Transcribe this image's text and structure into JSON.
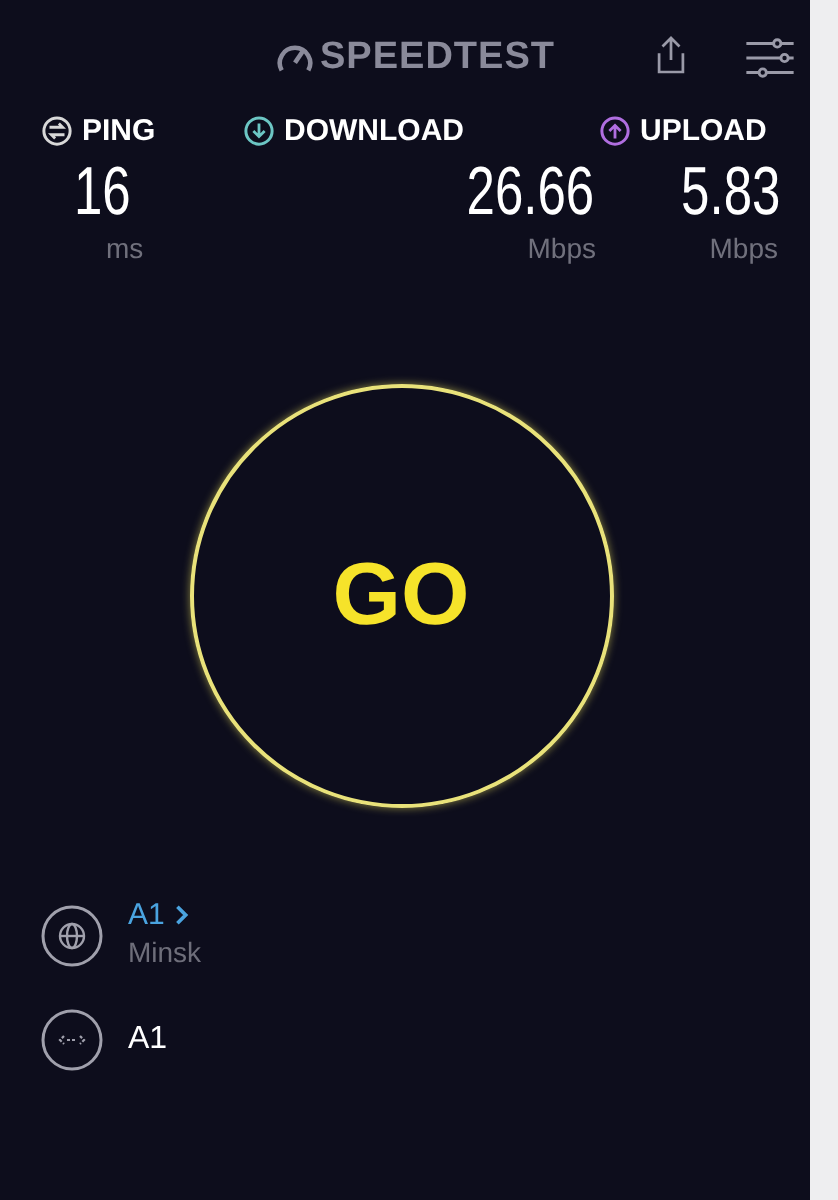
{
  "header": {
    "logo": "SPEEDTEST"
  },
  "metrics": [
    {
      "kind": "ping",
      "label": "PING",
      "value": "16",
      "unit": "ms",
      "color": "#d8d8d8"
    },
    {
      "kind": "download",
      "label": "DOWNLOAD",
      "value": "26.66",
      "unit": "Mbps",
      "color": "#6cc6c4"
    },
    {
      "kind": "upload",
      "label": "UPLOAD",
      "value": "5.83",
      "unit": "Mbps",
      "color": "#b06ee0"
    }
  ],
  "go": {
    "label": "GO"
  },
  "provider": {
    "name": "A1",
    "location": "Minsk"
  },
  "server": {
    "name": "A1"
  }
}
